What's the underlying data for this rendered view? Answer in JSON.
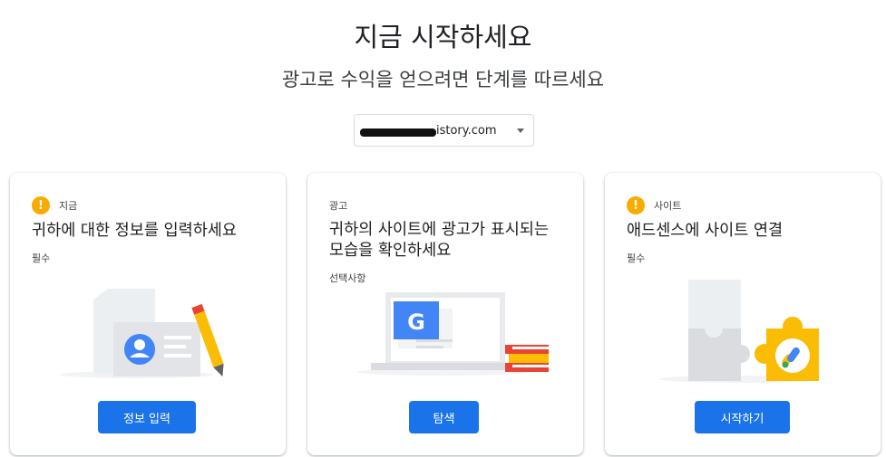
{
  "header": {
    "title": "지금 시작하세요",
    "subtitle": "광고로 수익을 얻으려면 단계를 따르세요"
  },
  "site_select": {
    "value": "istory.com",
    "icon": "chevron-down-icon"
  },
  "cards": [
    {
      "status_label": "지금",
      "status_icon": "warning-icon",
      "title": "귀하에 대한 정보를 입력하세요",
      "requirement": "필수",
      "button": "정보 입력"
    },
    {
      "status_label": "광고",
      "title": "귀하의 사이트에 광고가 표시되는 모습을 확인하세요",
      "requirement": "선택사항",
      "button": "탐색"
    },
    {
      "status_label": "사이트",
      "status_icon": "warning-icon",
      "title": "애드센스에 사이트 연결",
      "requirement": "필수",
      "button": "시작하기"
    }
  ],
  "colors": {
    "primary": "#1a73e8",
    "warning": "#f9ab00"
  }
}
